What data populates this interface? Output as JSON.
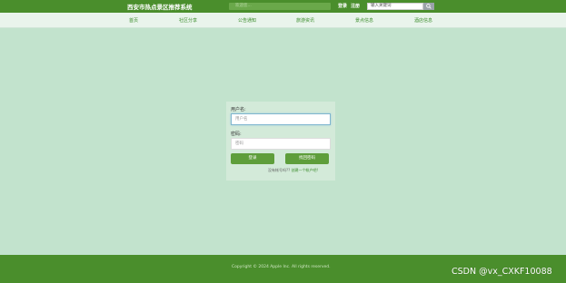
{
  "header": {
    "site_title": "西安市热点景区推荐系统",
    "notice_placeholder": "欢迎您...",
    "login_label": "登录",
    "register_label": "注册",
    "search_placeholder": "输入关键词",
    "search_icon": "search-icon"
  },
  "nav": {
    "items": [
      "首页",
      "社区分享",
      "公告通知",
      "旅游资讯",
      "景点信息",
      "酒店信息"
    ]
  },
  "login": {
    "username_label": "用户名:",
    "username_placeholder": "用户名",
    "password_label": "密码:",
    "password_placeholder": "密码",
    "login_button": "登录",
    "reset_button": "找回密码",
    "register_prompt": "没有帐号吗??",
    "register_link": "创建一个帐户吧!"
  },
  "footer": {
    "copyright": "Copyright © 2024 Apple Inc. All rights reserved."
  },
  "watermark": "CSDN @vx_CXKF10088",
  "colors": {
    "header_bg": "#4a8e2c",
    "page_bg": "#c2e3cd",
    "accent_green": "#5e9e3b"
  }
}
